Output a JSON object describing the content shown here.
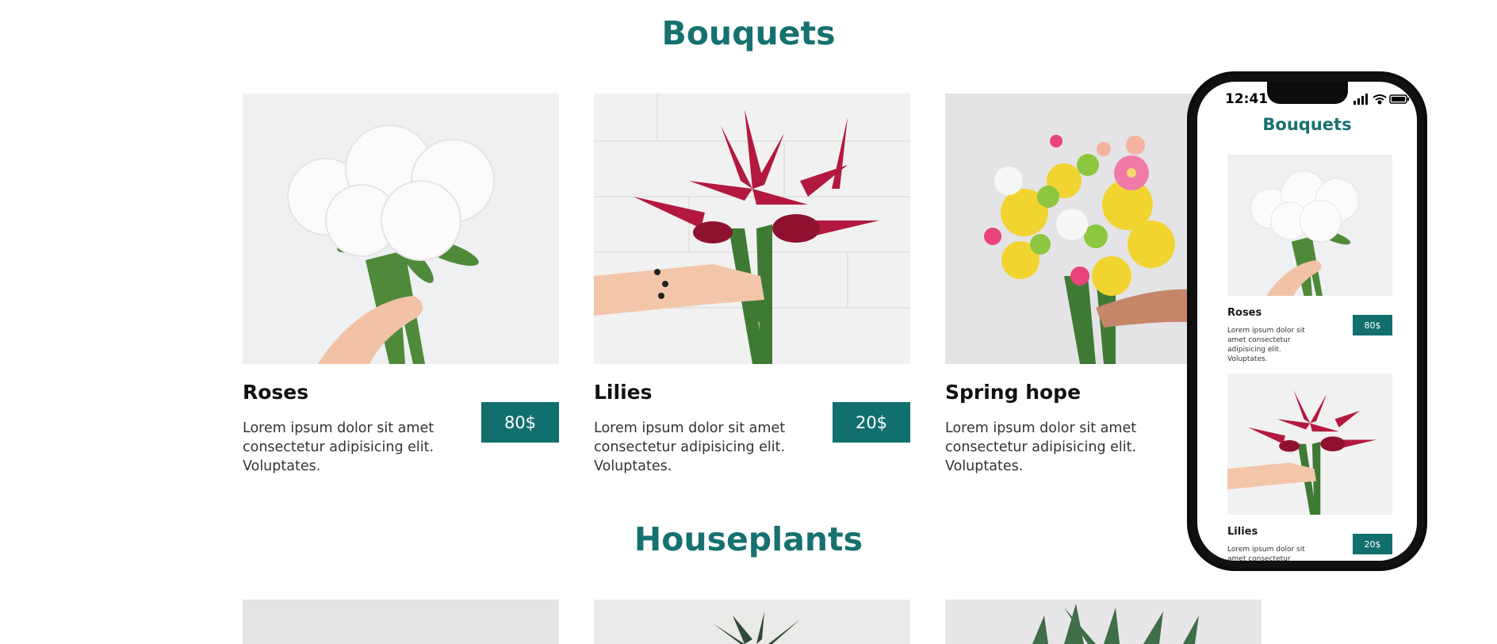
{
  "sections": {
    "bouquets": {
      "title": "Bouquets",
      "items": [
        {
          "name": "Roses",
          "price": "80$",
          "description": "Lorem ipsum dolor sit amet consectetur adipisicing elit. Voluptates."
        },
        {
          "name": "Lilies",
          "price": "20$",
          "description": "Lorem ipsum dolor sit amet consectetur adipisicing elit. Voluptates."
        },
        {
          "name": "Spring hope",
          "price": "",
          "description": "Lorem ipsum dolor sit amet consectetur adipisicing elit. Voluptates."
        }
      ]
    },
    "houseplants": {
      "title": "Houseplants"
    }
  },
  "phone": {
    "time": "12:41",
    "title": "Bouquets",
    "items": [
      {
        "name": "Roses",
        "price": "80$",
        "description": "Lorem ipsum dolor sit amet consectetur adipisicing elit. Voluptates."
      },
      {
        "name": "Lilies",
        "price": "20$",
        "description": "Lorem ipsum dolor sit amet consectetur adipisicing elit."
      }
    ]
  },
  "colors": {
    "accent": "#167170",
    "button": "#11706e"
  },
  "icons": [
    "signal-icon",
    "wifi-icon",
    "battery-icon"
  ]
}
